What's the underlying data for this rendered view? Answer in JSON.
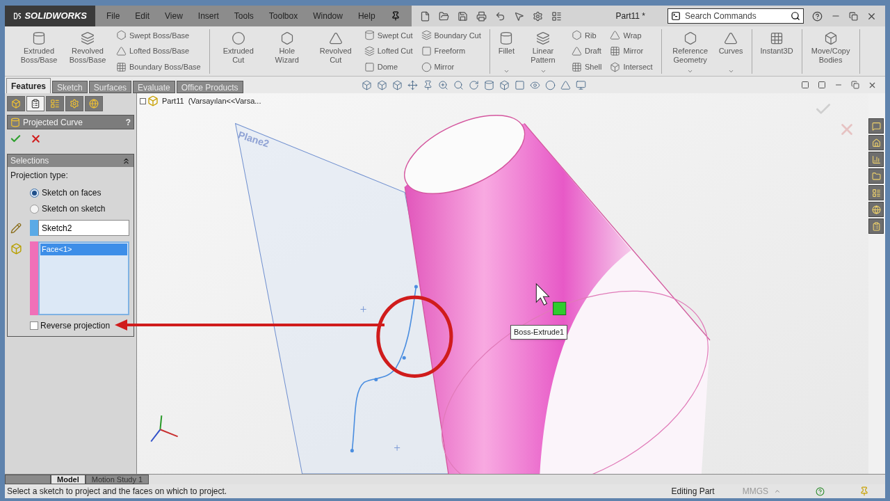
{
  "title_bar": {
    "logo": "SOLIDWORKS",
    "menu": [
      "File",
      "Edit",
      "View",
      "Insert",
      "Tools",
      "Toolbox",
      "Window",
      "Help"
    ],
    "document": "Part11 *",
    "search": {
      "placeholder": "Search Commands"
    }
  },
  "ribbon": {
    "groups": [
      {
        "items": [
          {
            "kind": "large",
            "label": "Extruded Boss/Base",
            "dropdown": false
          },
          {
            "kind": "large",
            "label": "Revolved Boss/Base",
            "dropdown": false
          },
          {
            "kind": "stack",
            "items": [
              "Swept Boss/Base",
              "Lofted Boss/Base",
              "Boundary Boss/Base"
            ]
          }
        ]
      },
      {
        "items": [
          {
            "kind": "large",
            "label": "Extruded Cut",
            "dropdown": false
          },
          {
            "kind": "large",
            "label": "Hole Wizard",
            "dropdown": false
          },
          {
            "kind": "large",
            "label": "Revolved Cut",
            "dropdown": false
          },
          {
            "kind": "stack",
            "items": [
              "Swept Cut",
              "Lofted Cut",
              "Dome"
            ]
          },
          {
            "kind": "stack",
            "items": [
              "Boundary Cut",
              "Freeform",
              "Mirror"
            ]
          }
        ]
      },
      {
        "items": [
          {
            "kind": "large",
            "label": "Fillet",
            "dropdown": true
          },
          {
            "kind": "large",
            "label": "Linear Pattern",
            "dropdown": true
          },
          {
            "kind": "stack",
            "items": [
              "Rib",
              "Draft",
              "Shell"
            ]
          },
          {
            "kind": "stack",
            "items": [
              "Wrap",
              "Mirror",
              "Intersect"
            ]
          }
        ]
      },
      {
        "items": [
          {
            "kind": "large",
            "label": "Reference Geometry",
            "dropdown": true
          },
          {
            "kind": "large",
            "label": "Curves",
            "dropdown": true
          }
        ]
      },
      {
        "items": [
          {
            "kind": "large",
            "label": "Instant3D",
            "dropdown": false
          }
        ]
      },
      {
        "items": [
          {
            "kind": "large",
            "label": "Move/Copy Bodies",
            "dropdown": false
          }
        ]
      }
    ]
  },
  "command_tabs": [
    {
      "label": "Features",
      "selected": true
    },
    {
      "label": "Sketch",
      "selected": false
    },
    {
      "label": "Surfaces",
      "selected": false
    },
    {
      "label": "Evaluate",
      "selected": false
    },
    {
      "label": "Office Products",
      "selected": false
    }
  ],
  "property_manager": {
    "manager_tabs": [
      {
        "selected": false
      },
      {
        "selected": true
      },
      {
        "selected": false
      },
      {
        "selected": false
      },
      {
        "selected": false
      }
    ],
    "title": "Projected Curve",
    "help": "?",
    "selections": {
      "title": "Selections",
      "projection_type_label": "Projection type:",
      "options": [
        {
          "label": "Sketch on faces",
          "selected": true
        },
        {
          "label": "Sketch on sketch",
          "selected": false
        }
      ],
      "sketch_field": {
        "value": "Sketch2",
        "color": "#5aaae6"
      },
      "face_list": {
        "color": "#f070b8",
        "items": [
          {
            "label": "Face<1>",
            "selected": true
          }
        ]
      },
      "reverse_projection": {
        "label": "Reverse projection",
        "checked": false
      }
    }
  },
  "viewport": {
    "tree_root": "Part11  (Varsayılan<<Varsa...",
    "plane_label": "Plane2",
    "tooltip": "Boss-Extrude1"
  },
  "bottom_tabs": [
    {
      "label": "Model",
      "selected": true
    },
    {
      "label": "Motion Study 1",
      "selected": false
    }
  ],
  "status_bar": {
    "message": "Select a sketch to project and the faces on which to project.",
    "mode": "Editing Part",
    "units": "MMGS"
  }
}
